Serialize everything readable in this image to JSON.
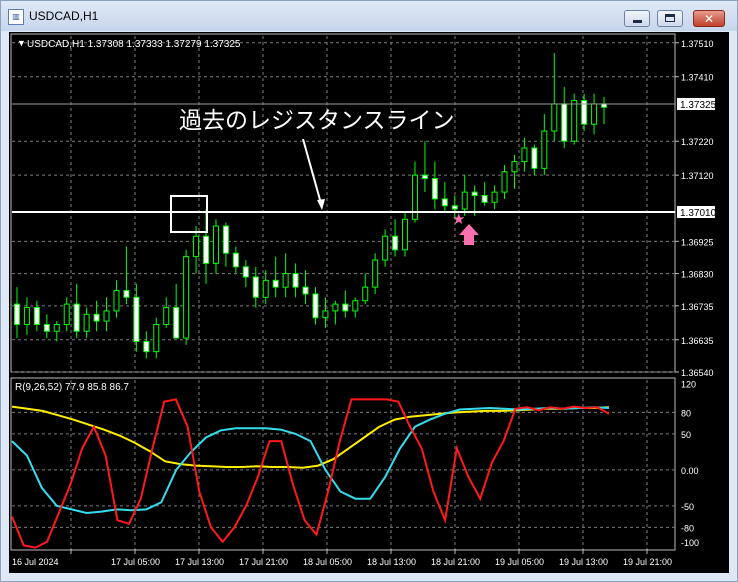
{
  "window": {
    "title": "USDCAD,H1",
    "icon": "chart-window-icon",
    "minimize_icon": "minimize-icon",
    "maximize_icon": "maximize-icon",
    "close_icon": "close-icon",
    "close_glyph": "✕"
  },
  "chart": {
    "header_text": "USDCAD,H1  1.37308 1.37333 1.37279 1.37325",
    "annotation": "過去のレジスタンスライン",
    "current_price_label": "1.37325",
    "line_price_label": "1.37010",
    "price_ticks": [
      "1.37510",
      "1.37410",
      "1.37220",
      "1.37120",
      "1.36925",
      "1.36830",
      "1.36735",
      "1.36635",
      "1.36540"
    ],
    "colors": {
      "bull": "#00ff00",
      "bear_fill": "#ffffff",
      "grid": "#7c7c7c",
      "line": "#ffffff",
      "star": "#ff6fb0",
      "arrow": "#ff6fb0"
    }
  },
  "indicator": {
    "header_text": "R(9,26,52) 77.9 85.8 86.7",
    "scale_ticks": [
      "120",
      "80",
      "50",
      "0.00",
      "-50",
      "-80",
      "-100"
    ],
    "colors": {
      "fast": "#ff1a1a",
      "mid": "#33ddee",
      "slow": "#ffee00"
    }
  },
  "time_axis": [
    "16 Jul 2024",
    "17 Jul 05:00",
    "17 Jul 13:00",
    "17 Jul 21:00",
    "18 Jul 05:00",
    "18 Jul 13:00",
    "18 Jul 21:00",
    "19 Jul 05:00",
    "19 Jul 13:00",
    "19 Jul 21:00"
  ],
  "chart_data": {
    "type": "candlestick",
    "symbol": "USDCAD",
    "timeframe": "H1",
    "price_ylim": [
      1.3654,
      1.3753
    ],
    "candles_ohlc": [
      [
        1.3674,
        1.3679,
        1.3664,
        1.3668
      ],
      [
        1.3668,
        1.3676,
        1.3665,
        1.3673
      ],
      [
        1.3673,
        1.3675,
        1.3666,
        1.3668
      ],
      [
        1.3668,
        1.3671,
        1.3664,
        1.3666
      ],
      [
        1.3666,
        1.3669,
        1.3663,
        1.3668
      ],
      [
        1.3668,
        1.3676,
        1.3666,
        1.3674
      ],
      [
        1.3674,
        1.368,
        1.3664,
        1.3666
      ],
      [
        1.3666,
        1.3673,
        1.3664,
        1.3671
      ],
      [
        1.3671,
        1.3675,
        1.3666,
        1.3669
      ],
      [
        1.3669,
        1.3676,
        1.3666,
        1.3672
      ],
      [
        1.3672,
        1.3681,
        1.367,
        1.3678
      ],
      [
        1.3678,
        1.3691,
        1.3674,
        1.3676
      ],
      [
        1.3676,
        1.368,
        1.366,
        1.3663
      ],
      [
        1.3663,
        1.3666,
        1.3658,
        1.366
      ],
      [
        1.366,
        1.367,
        1.3658,
        1.3668
      ],
      [
        1.3668,
        1.3676,
        1.3667,
        1.3673
      ],
      [
        1.3673,
        1.368,
        1.3665,
        1.3664
      ],
      [
        1.3664,
        1.369,
        1.3662,
        1.3688
      ],
      [
        1.3688,
        1.3697,
        1.3683,
        1.3694
      ],
      [
        1.3694,
        1.3702,
        1.368,
        1.3686
      ],
      [
        1.3686,
        1.3699,
        1.3683,
        1.3697
      ],
      [
        1.3697,
        1.3698,
        1.3685,
        1.3689
      ],
      [
        1.3689,
        1.3691,
        1.3683,
        1.3685
      ],
      [
        1.3685,
        1.3687,
        1.3679,
        1.3682
      ],
      [
        1.3682,
        1.3685,
        1.3673,
        1.3676
      ],
      [
        1.3676,
        1.3684,
        1.3674,
        1.3681
      ],
      [
        1.3681,
        1.3688,
        1.3676,
        1.3679
      ],
      [
        1.3679,
        1.3689,
        1.3676,
        1.3683
      ],
      [
        1.3683,
        1.3686,
        1.3676,
        1.3679
      ],
      [
        1.3679,
        1.3684,
        1.3674,
        1.3677
      ],
      [
        1.3677,
        1.3679,
        1.3668,
        1.367
      ],
      [
        1.367,
        1.3676,
        1.3667,
        1.3672
      ],
      [
        1.3672,
        1.3675,
        1.3668,
        1.3674
      ],
      [
        1.3674,
        1.3678,
        1.367,
        1.3672
      ],
      [
        1.3672,
        1.3676,
        1.367,
        1.3675
      ],
      [
        1.3675,
        1.3683,
        1.3674,
        1.3679
      ],
      [
        1.3679,
        1.3689,
        1.3677,
        1.3687
      ],
      [
        1.3687,
        1.3696,
        1.3685,
        1.3694
      ],
      [
        1.3694,
        1.3699,
        1.3688,
        1.369
      ],
      [
        1.369,
        1.3701,
        1.3688,
        1.3699
      ],
      [
        1.3699,
        1.3716,
        1.3698,
        1.3712
      ],
      [
        1.3712,
        1.3722,
        1.3707,
        1.3711
      ],
      [
        1.3711,
        1.3716,
        1.3702,
        1.3705
      ],
      [
        1.3705,
        1.371,
        1.3701,
        1.3703
      ],
      [
        1.3703,
        1.3706,
        1.3699,
        1.3702
      ],
      [
        1.3702,
        1.3712,
        1.37,
        1.3707
      ],
      [
        1.3707,
        1.3709,
        1.37,
        1.3706
      ],
      [
        1.3706,
        1.371,
        1.3703,
        1.3704
      ],
      [
        1.3704,
        1.3709,
        1.3702,
        1.3707
      ],
      [
        1.3707,
        1.3715,
        1.3705,
        1.3713
      ],
      [
        1.3713,
        1.3718,
        1.3708,
        1.3716
      ],
      [
        1.3716,
        1.3723,
        1.3713,
        1.372
      ],
      [
        1.372,
        1.3721,
        1.3712,
        1.3714
      ],
      [
        1.3714,
        1.373,
        1.3712,
        1.3725
      ],
      [
        1.3725,
        1.3748,
        1.3722,
        1.3733
      ],
      [
        1.3733,
        1.3738,
        1.372,
        1.3722
      ],
      [
        1.3722,
        1.3736,
        1.3721,
        1.3734
      ],
      [
        1.3734,
        1.3736,
        1.3725,
        1.3727
      ],
      [
        1.3727,
        1.3736,
        1.3724,
        1.3733
      ],
      [
        1.3733,
        1.3735,
        1.3727,
        1.3732
      ]
    ],
    "horizontal_line": 1.3701,
    "indicator": {
      "name": "R(9,26,52)",
      "ylim": [
        -110,
        125
      ],
      "fast": [
        -65,
        -105,
        -108,
        -100,
        -60,
        -20,
        30,
        60,
        20,
        -70,
        -75,
        -40,
        30,
        95,
        98,
        60,
        -30,
        -80,
        -100,
        -80,
        -50,
        -10,
        40,
        40,
        -20,
        -70,
        -90,
        -30,
        40,
        98,
        98,
        98,
        98,
        95,
        60,
        30,
        -30,
        -70,
        30,
        -10,
        -40,
        10,
        40,
        85,
        87,
        83,
        87,
        85,
        88,
        86,
        87,
        78
      ],
      "mid": [
        40,
        20,
        -25,
        -50,
        -55,
        -60,
        -58,
        -55,
        -56,
        -55,
        -45,
        0,
        25,
        45,
        55,
        58,
        58,
        58,
        56,
        50,
        40,
        0,
        -30,
        -40,
        -40,
        -10,
        30,
        60,
        70,
        78,
        84,
        85,
        86,
        85,
        84,
        85,
        86,
        85,
        86,
        87,
        86
      ],
      "slow": [
        88,
        85,
        82,
        76,
        70,
        63,
        56,
        48,
        38,
        26,
        12,
        8,
        6,
        5,
        4,
        4,
        5,
        4,
        4,
        3,
        6,
        15,
        30,
        45,
        60,
        70,
        74,
        76,
        78,
        80,
        81,
        82,
        82,
        83,
        84,
        85,
        85,
        86,
        86,
        87
      ]
    }
  }
}
